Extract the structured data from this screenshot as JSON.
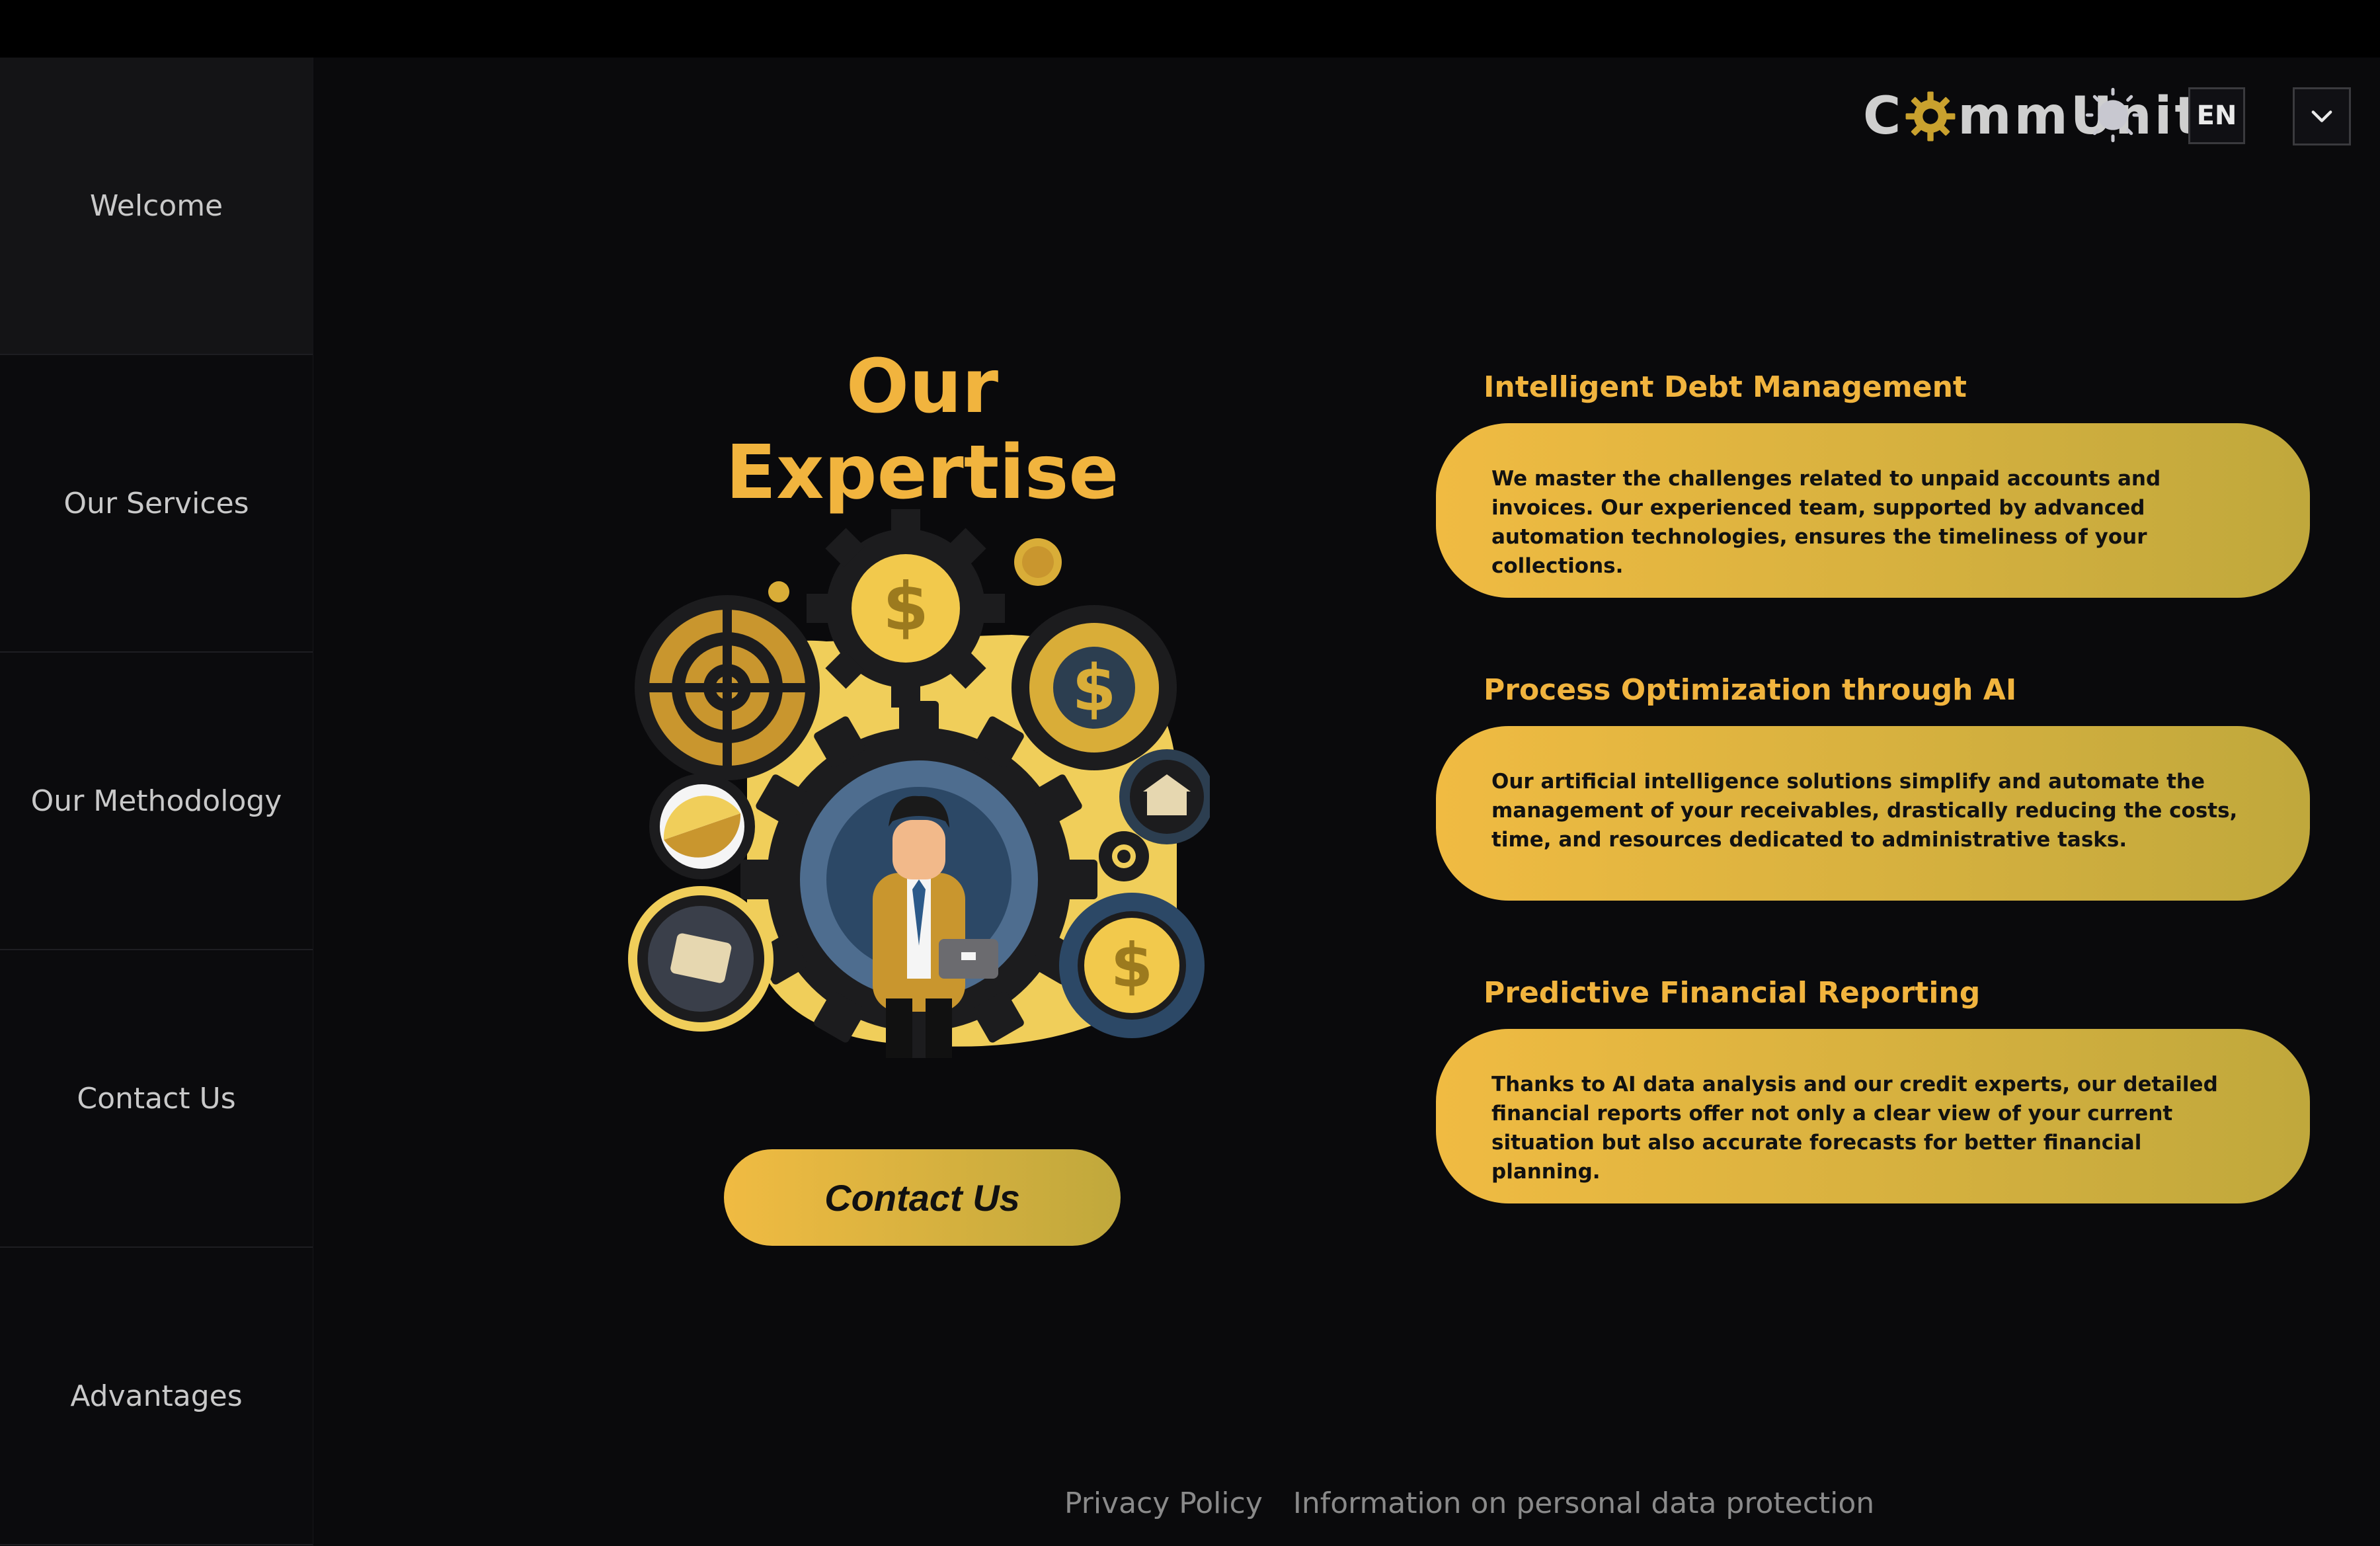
{
  "brand": {
    "logo_left": "C",
    "logo_right": "mmUnite",
    "accent_color": "#f1b43e",
    "card_gradient_start": "#f0bb42",
    "card_gradient_end": "#c0a83c"
  },
  "sidebar": {
    "items": [
      {
        "label": "Welcome"
      },
      {
        "label": "Our Services"
      },
      {
        "label": "Our Methodology"
      },
      {
        "label": "Contact Us"
      },
      {
        "label": "Advantages"
      }
    ]
  },
  "header": {
    "theme_icon": "sun-icon",
    "language": "EN",
    "dropdown_icon": "chevron-down-icon"
  },
  "main": {
    "title": "Our Expertise",
    "cta_label": "Contact Us"
  },
  "services": [
    {
      "title": "Intelligent Debt Management",
      "description": "We master the challenges related to unpaid accounts and invoices. Our experienced team, supported by advanced automation technologies, ensures the timeliness of your collections."
    },
    {
      "title": "Process Optimization through AI",
      "description": "Our artificial intelligence solutions simplify and automate the management of your receivables, drastically reducing the costs, time, and resources dedicated to administrative tasks."
    },
    {
      "title": "Predictive Financial Reporting",
      "description": "Thanks to AI data analysis and our credit experts, our detailed financial reports offer not only a clear view of your current situation but also accurate forecasts for better financial planning."
    }
  ],
  "footer": {
    "privacy": "Privacy Policy",
    "data_protection": "Information on personal data protection"
  }
}
